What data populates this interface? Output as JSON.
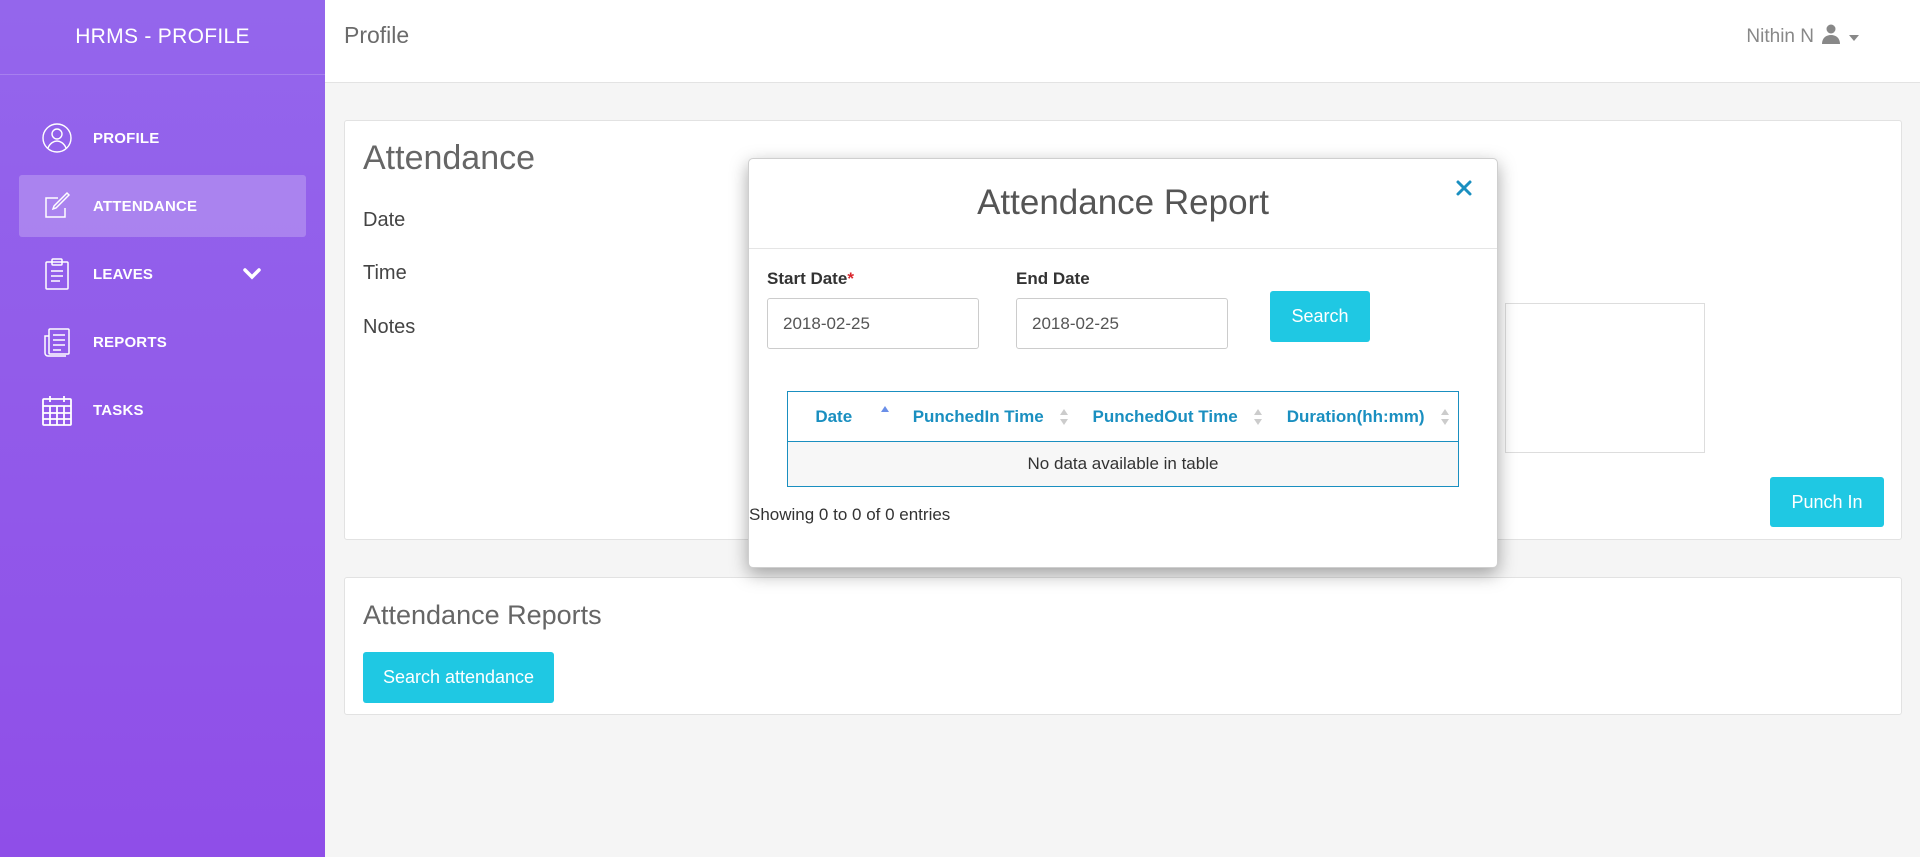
{
  "sidebar": {
    "brand": "HRMS - PROFILE",
    "items": [
      {
        "label": "PROFILE",
        "icon": "user-circle-icon"
      },
      {
        "label": "ATTENDANCE",
        "icon": "edit-icon",
        "active": true
      },
      {
        "label": "LEAVES",
        "icon": "clipboard-icon",
        "expandable": true
      },
      {
        "label": "REPORTS",
        "icon": "report-icon"
      },
      {
        "label": "TASKS",
        "icon": "calendar-icon"
      }
    ]
  },
  "header": {
    "title": "Profile",
    "user_name": "Nithin N"
  },
  "attendance_card": {
    "title": "Attendance",
    "fields": [
      "Date",
      "Time",
      "Notes"
    ],
    "punch_button": "Punch In"
  },
  "reports_card": {
    "title": "Attendance Reports",
    "search_button": "Search attendance"
  },
  "modal": {
    "title": "Attendance Report",
    "close_icon": "close-icon",
    "start_date_label": "Start Date",
    "required_mark": "*",
    "end_date_label": "End Date",
    "start_date_value": "2018-02-25",
    "end_date_value": "2018-02-25",
    "search_button": "Search",
    "table": {
      "columns": [
        "Date",
        "PunchedIn Time",
        "PunchedOut Time",
        "Duration(hh:mm)"
      ],
      "empty_message": "No data available in table"
    },
    "info": "Showing 0 to 0 of 0 entries"
  },
  "colors": {
    "sidebar_gradient_start": "#9466ec",
    "sidebar_gradient_end": "#8f4ee8",
    "accent_cyan": "#1fc8e3",
    "table_blue": "#1a8fc0",
    "required_red": "#d9262c"
  }
}
